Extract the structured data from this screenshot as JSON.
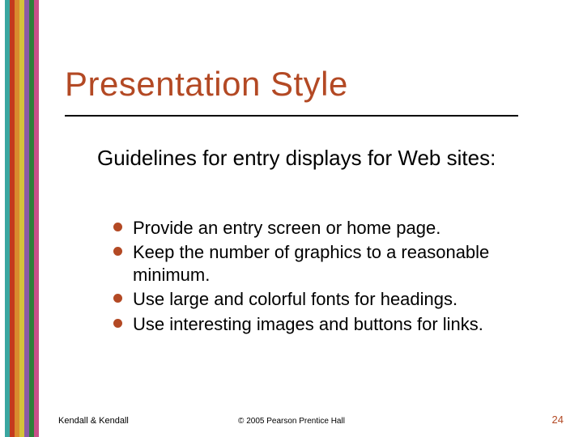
{
  "stripe_colors": [
    "#3aa6a0",
    "#c43a1e",
    "#d98b2e",
    "#d4c23a",
    "#8a5aa6",
    "#2e7f3a",
    "#c94f8a"
  ],
  "title": "Presentation Style",
  "intro": "Guidelines for entry displays for Web sites:",
  "bullets": [
    "Provide an entry screen or home page.",
    "Keep the number of graphics to a reasonable minimum.",
    "Use large and colorful fonts for headings.",
    "Use interesting images and buttons for links."
  ],
  "footer": {
    "left": "Kendall & Kendall",
    "center": "© 2005 Pearson Prentice Hall",
    "right": "24"
  }
}
